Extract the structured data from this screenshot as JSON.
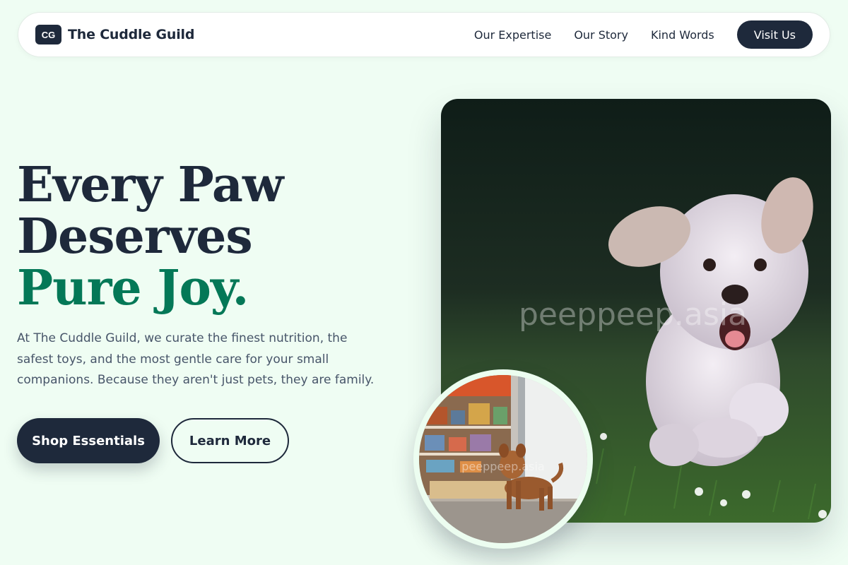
{
  "nav": {
    "logo_mark": "CG",
    "brand_name": "The Cuddle Guild",
    "links": [
      "Our Expertise",
      "Our Story",
      "Kind Words"
    ],
    "cta": "Visit Us"
  },
  "hero": {
    "headline_line1": "Every Paw",
    "headline_line2": "Deserves",
    "headline_accent": "Pure Joy.",
    "description": "At The Cuddle Guild, we curate the finest nutrition, the safest toys, and the most gentle care for your small companions. Because they aren't just pets, they are family.",
    "primary_cta": "Shop Essentials",
    "secondary_cta": "Learn More",
    "watermark": "peeppeep.asia"
  },
  "colors": {
    "background": "#effdf3",
    "navy": "#1e293b",
    "accent_green": "#047857"
  },
  "icons": {
    "hero_photo": "running-white-dog-photo",
    "inset_photo": "brown-puppy-in-pet-shop-photo"
  }
}
